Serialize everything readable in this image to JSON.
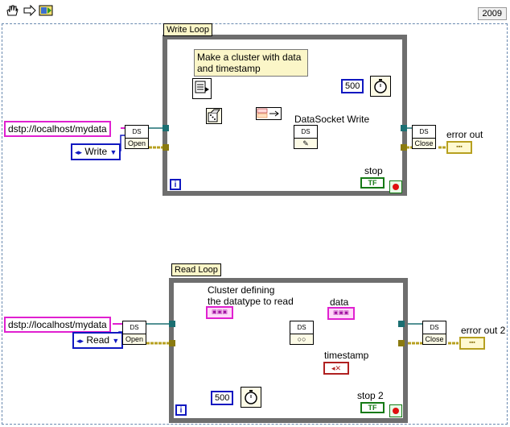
{
  "toolbar": {
    "icons": [
      "hand-icon",
      "run-arrow-icon",
      "tool-palette-icon"
    ],
    "version": "2009"
  },
  "write_loop": {
    "label": "Write Loop",
    "url": "dstp://localhost/mydata",
    "mode": "Write",
    "open_label": "Open",
    "close_label": "Close",
    "note": [
      "Make a cluster with data",
      "and timestamp"
    ],
    "write_label": "DataSocket Write",
    "wait_ms": "500",
    "stop_label": "stop",
    "tf": "TF",
    "iter": "i",
    "error_out": "error out"
  },
  "read_loop": {
    "label": "Read Loop",
    "url": "dstp://localhost/mydata",
    "mode": "Read",
    "open_label": "Open",
    "close_label": "Close",
    "note": [
      "Cluster defining",
      "the datatype to read"
    ],
    "data_label": "data",
    "timestamp_label": "timestamp",
    "wait_ms": "500",
    "stop_label": "stop 2",
    "tf": "TF",
    "iter": "i",
    "error_out": "error out 2"
  },
  "colors": {
    "string_wire": "#e020d0",
    "enum_wire": "#1018c0",
    "error_wire": "#b7a020",
    "refnum_wire": "#1b6f72",
    "timestamp_wire": "#b02020",
    "loop_border": "#6e6e6e"
  }
}
